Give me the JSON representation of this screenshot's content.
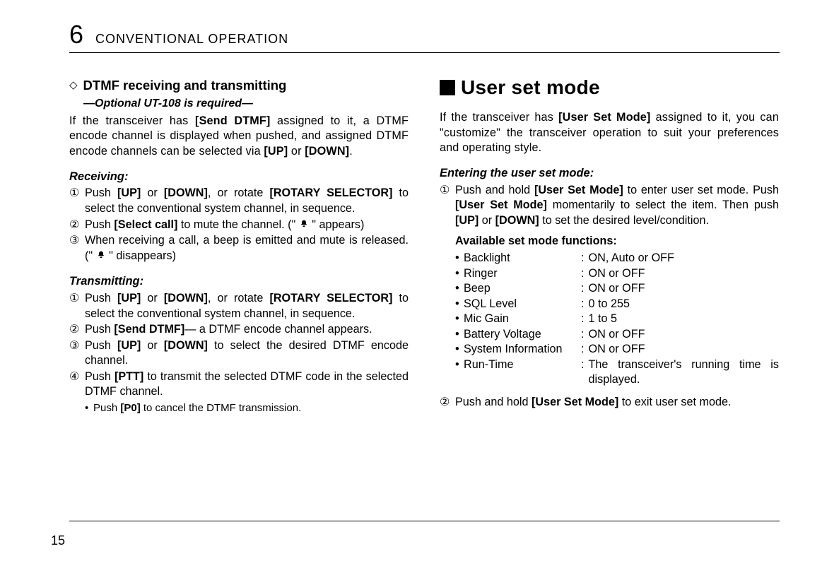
{
  "header": {
    "chapter_num": "6",
    "chapter_title": "CONVENTIONAL OPERATION"
  },
  "left": {
    "diamond": "◇",
    "title": "DTMF receiving and transmitting",
    "subtitle": "—Optional UT-108 is required—",
    "intro_pre": "If the transceiver has ",
    "intro_key": "[Send DTMF]",
    "intro_post": " assigned to it, a DTMF encode channel is displayed when pushed, and assigned DTMF encode channels can be selected via ",
    "intro_up": "[UP]",
    "intro_or": " or ",
    "intro_down": "[DOWN]",
    "intro_period": ".",
    "rx_head": "Receiving:",
    "rx1_num": "①",
    "rx1_a": "Push ",
    "rx1_up": "[UP]",
    "rx1_b": " or ",
    "rx1_down": "[DOWN]",
    "rx1_c": ", or rotate ",
    "rx1_rot": "[ROTARY SELECTOR]",
    "rx1_d": " to select the conventional system channel, in sequence.",
    "rx2_num": "②",
    "rx2_a": "Push ",
    "rx2_sel": "[Select call]",
    "rx2_b": " to mute the channel. (\" ",
    "rx2_c": " \" appears)",
    "rx3_num": "③",
    "rx3_a": "When receiving a call, a beep is emitted and mute is released. (\" ",
    "rx3_b": " \" disappears)",
    "tx_head": "Transmitting:",
    "tx1_num": "①",
    "tx1_a": "Push ",
    "tx1_up": "[UP]",
    "tx1_b": " or ",
    "tx1_down": "[DOWN]",
    "tx1_c": ", or rotate ",
    "tx1_rot": "[ROTARY SELECTOR]",
    "tx1_d": " to select the conventional system channel, in sequence.",
    "tx2_num": "②",
    "tx2_a": "Push ",
    "tx2_key": "[Send DTMF]",
    "tx2_b": "— a DTMF encode channel appears.",
    "tx3_num": "③",
    "tx3_a": "Push ",
    "tx3_up": "[UP]",
    "tx3_b": " or ",
    "tx3_down": "[DOWN]",
    "tx3_c": " to select the desired DTMF encode channel.",
    "tx4_num": "④",
    "tx4_a": "Push ",
    "tx4_ptt": "[PTT]",
    "tx4_b": " to transmit the selected DTMF code in the selected DTMF channel.",
    "tx_sub_a": "Push ",
    "tx_sub_key": "[P0]",
    "tx_sub_b": " to cancel the DTMF transmission."
  },
  "right": {
    "title": "User set mode",
    "intro_a": "If the transceiver has ",
    "intro_key": "[User Set Mode]",
    "intro_b": " assigned to it, you can \"customize\" the transceiver operation to suit your preferences and operating style.",
    "enter_head": "Entering the user set mode:",
    "s1_num": "①",
    "s1_a": "Push and hold ",
    "s1_k1": "[User Set Mode]",
    "s1_b": " to enter user set mode. Push ",
    "s1_k2": "[User Set Mode]",
    "s1_c": " momentarily to select the item. Then push ",
    "s1_up": "[UP]",
    "s1_d": " or ",
    "s1_down": "[DOWN]",
    "s1_e": " to set the desired level/condition.",
    "funcs_head": "Available set mode functions:",
    "funcs": [
      {
        "label": "Backlight",
        "value": "ON, Auto or OFF"
      },
      {
        "label": "Ringer",
        "value": "ON or OFF"
      },
      {
        "label": "Beep",
        "value": "ON or OFF"
      },
      {
        "label": "SQL Level",
        "value": "0 to 255"
      },
      {
        "label": "Mic Gain",
        "value": "1 to 5"
      },
      {
        "label": "Battery Voltage",
        "value": "ON or OFF"
      },
      {
        "label": "System Information",
        "value": "ON or OFF"
      },
      {
        "label": "Run-Time",
        "value": "The transceiver's running time is displayed."
      }
    ],
    "s2_num": "②",
    "s2_a": "Push and hold ",
    "s2_k": "[User Set Mode]",
    "s2_b": " to exit user set mode."
  },
  "footer": {
    "page_num": "15"
  }
}
